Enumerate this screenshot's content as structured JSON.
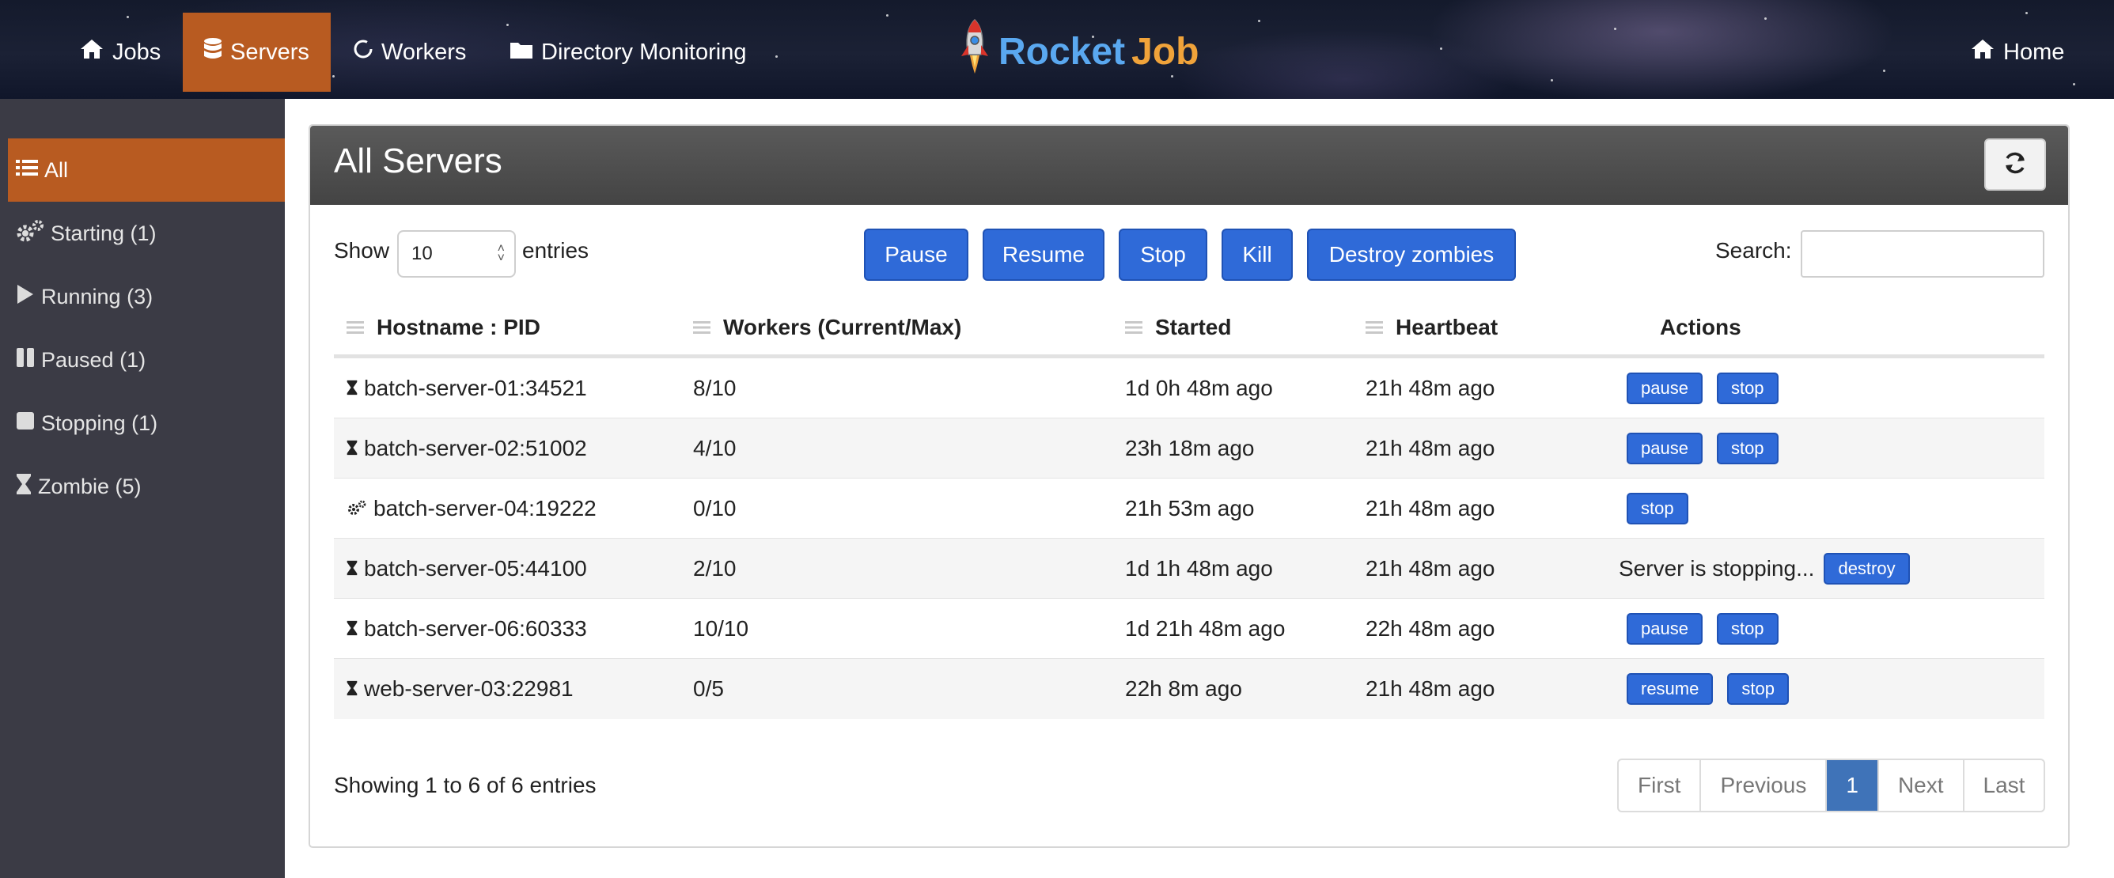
{
  "nav": {
    "items": [
      {
        "label": "Jobs",
        "icon": "home-icon"
      },
      {
        "label": "Servers",
        "icon": "database-icon",
        "active": true
      },
      {
        "label": "Workers",
        "icon": "refresh-circle-icon"
      },
      {
        "label": "Directory Monitoring",
        "icon": "folder-icon"
      }
    ],
    "brand_part1": "Rocket",
    "brand_part2": "Job",
    "home_label": "Home"
  },
  "sidebar": {
    "items": [
      {
        "label": "All",
        "icon": "list-icon",
        "active": true
      },
      {
        "label": "Starting (1)",
        "icon": "gears-icon"
      },
      {
        "label": "Running (3)",
        "icon": "play-icon"
      },
      {
        "label": "Paused (1)",
        "icon": "pause-icon"
      },
      {
        "label": "Stopping (1)",
        "icon": "stop-icon"
      },
      {
        "label": "Zombie (5)",
        "icon": "hourglass-icon"
      }
    ]
  },
  "panel": {
    "title": "All Servers",
    "show_label": "Show",
    "page_length": "10",
    "entries_label": "entries",
    "search_label": "Search:",
    "search_value": "",
    "bulk_actions": [
      "Pause",
      "Resume",
      "Stop",
      "Kill",
      "Destroy zombies"
    ]
  },
  "table": {
    "headers": [
      "Hostname : PID",
      "Workers (Current/Max)",
      "Started",
      "Heartbeat",
      "Actions"
    ],
    "rows": [
      {
        "host": "batch-server-01:34521",
        "icon": "hourglass-icon",
        "workers": "8/10",
        "started": "1d 0h 48m ago",
        "heartbeat": "21h 48m ago",
        "status": "",
        "actions": [
          "pause",
          "stop"
        ]
      },
      {
        "host": "batch-server-02:51002",
        "icon": "hourglass-icon",
        "workers": "4/10",
        "started": "23h 18m ago",
        "heartbeat": "21h 48m ago",
        "status": "",
        "actions": [
          "pause",
          "stop"
        ]
      },
      {
        "host": "batch-server-04:19222",
        "icon": "gears-icon",
        "workers": "0/10",
        "started": "21h 53m ago",
        "heartbeat": "21h 48m ago",
        "status": "",
        "actions": [
          "stop"
        ]
      },
      {
        "host": "batch-server-05:44100",
        "icon": "hourglass-icon",
        "workers": "2/10",
        "started": "1d 1h 48m ago",
        "heartbeat": "21h 48m ago",
        "status": "Server is stopping...",
        "actions": [
          "destroy"
        ]
      },
      {
        "host": "batch-server-06:60333",
        "icon": "hourglass-icon",
        "workers": "10/10",
        "started": "1d 21h 48m ago",
        "heartbeat": "22h 48m ago",
        "status": "",
        "actions": [
          "pause",
          "stop"
        ]
      },
      {
        "host": "web-server-03:22981",
        "icon": "hourglass-icon",
        "workers": "0/5",
        "started": "22h 8m ago",
        "heartbeat": "21h 48m ago",
        "status": "",
        "actions": [
          "resume",
          "stop"
        ]
      }
    ]
  },
  "footer": {
    "info": "Showing 1 to 6 of 6 entries",
    "pagination": [
      "First",
      "Previous",
      "1",
      "Next",
      "Last"
    ],
    "current_page": "1"
  },
  "colors": {
    "accent": "#b85b21",
    "button": "#2f6ad8",
    "sidebar": "#3b3b45",
    "page_current": "#3f73b8"
  }
}
